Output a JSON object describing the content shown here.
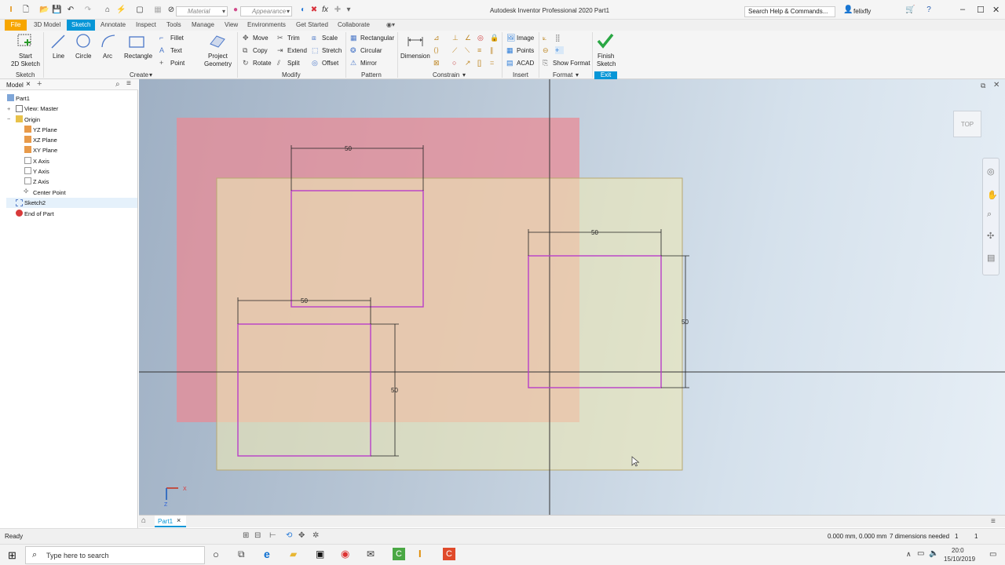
{
  "app": {
    "title": "Autodesk Inventor Professional 2020   Part1",
    "user": "felixfly"
  },
  "quick_access": {
    "material": "Material",
    "appearance": "Appearance"
  },
  "search": {
    "placeholder": "Search Help & Commands..."
  },
  "tabs": [
    "File",
    "3D Model",
    "Sketch",
    "Annotate",
    "Inspect",
    "Tools",
    "Manage",
    "View",
    "Environments",
    "Get Started",
    "Collaborate"
  ],
  "ribbon": {
    "sketch_panel": {
      "start_line1": "Start",
      "start_line2": "2D Sketch",
      "label": "Sketch"
    },
    "create": {
      "line": "Line",
      "circle": "Circle",
      "arc": "Arc",
      "rectangle": "Rectangle",
      "fillet": "Fillet",
      "text": "Text",
      "point": "Point",
      "project1": "Project",
      "project2": "Geometry",
      "label": "Create"
    },
    "modify": {
      "move": "Move",
      "copy": "Copy",
      "rotate": "Rotate",
      "trim": "Trim",
      "extend": "Extend",
      "split": "Split",
      "scale": "Scale",
      "stretch": "Stretch",
      "offset": "Offset",
      "label": "Modify"
    },
    "pattern": {
      "rectangular": "Rectangular",
      "circular": "Circular",
      "mirror": "Mirror",
      "label": "Pattern"
    },
    "constrain": {
      "dimension": "Dimension",
      "label": "Constrain"
    },
    "insert": {
      "image": "Image",
      "points": "Points",
      "acad": "ACAD",
      "label": "Insert"
    },
    "format": {
      "show_format": "Show Format",
      "label": "Format"
    },
    "exit": {
      "finish1": "Finish",
      "finish2": "Sketch",
      "label": "Exit"
    }
  },
  "browser": {
    "tab": "Model",
    "items": [
      "Part1",
      "View: Master",
      "Origin",
      "YZ Plane",
      "XZ Plane",
      "XY Plane",
      "X Axis",
      "Y Axis",
      "Z Axis",
      "Center Point",
      "Sketch2",
      "End of Part"
    ]
  },
  "viewcube": {
    "face": "TOP"
  },
  "dimensions": {
    "d1": "50",
    "d2": "50",
    "d3": "50",
    "d4": "50",
    "d5": "50"
  },
  "triad": {
    "x": "X",
    "y": "Y",
    "z": "Z"
  },
  "document_tab": "Part1",
  "status": {
    "left": "Ready",
    "coords": "0.000 mm, 0.000 mm",
    "dims": "7 dimensions needed",
    "n1": "1",
    "n2": "1"
  },
  "taskbar": {
    "search_placeholder": "Type here to search",
    "time": "20:0",
    "date": "15/10/2019"
  },
  "colors": {
    "accent": "#0696d7",
    "file_tab": "#f7a600",
    "sketch_line": "#b83ec9",
    "red_plane": "#e88b95",
    "green_plane": "#e6e2b8"
  }
}
